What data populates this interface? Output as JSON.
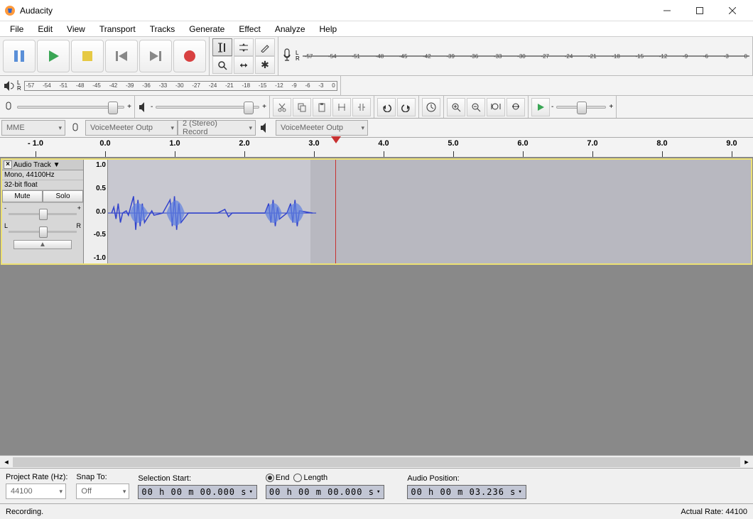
{
  "window": {
    "title": "Audacity"
  },
  "menu": [
    "File",
    "Edit",
    "View",
    "Transport",
    "Tracks",
    "Generate",
    "Effect",
    "Analyze",
    "Help"
  ],
  "transport": {
    "buttons": [
      "pause",
      "play",
      "stop",
      "skip-start",
      "skip-end",
      "record"
    ]
  },
  "meter_ticks": [
    "-57",
    "-54",
    "-51",
    "-48",
    "-45",
    "-42",
    "-39",
    "-36",
    "-33",
    "-30",
    "-27",
    "-24",
    "-21",
    "-18",
    "-15",
    "-12",
    "-9",
    "-6",
    "-3",
    "0"
  ],
  "devices": {
    "host": "MME",
    "rec_device": "VoiceMeeter Outp",
    "rec_channels": "2 (Stereo) Record",
    "play_device": "VoiceMeeter Outp"
  },
  "timeline_marks": [
    "- 1.0",
    "0.0",
    "1.0",
    "2.0",
    "3.0",
    "4.0",
    "5.0",
    "6.0",
    "7.0",
    "8.0",
    "9.0"
  ],
  "track": {
    "name": "Audio Track",
    "info1": "Mono, 44100Hz",
    "info2": "32-bit float",
    "mute": "Mute",
    "solo": "Solo",
    "gain_l": "-",
    "gain_r": "+",
    "pan_l": "L",
    "pan_r": "R",
    "vruler": [
      "1.0",
      "0.5",
      "0.0",
      "-0.5",
      "-1.0"
    ]
  },
  "selection": {
    "rate_label": "Project Rate (Hz):",
    "rate": "44100",
    "snap_label": "Snap To:",
    "snap": "Off",
    "start_label": "Selection Start:",
    "start": "00 h 00 m 00.000 s",
    "end_radio": "End",
    "length_radio": "Length",
    "end": "00 h 00 m 00.000 s",
    "pos_label": "Audio Position:",
    "pos": "00 h 00 m 03.236 s"
  },
  "status": {
    "msg": "Recording.",
    "rate_label": "Actual Rate: 44100"
  }
}
